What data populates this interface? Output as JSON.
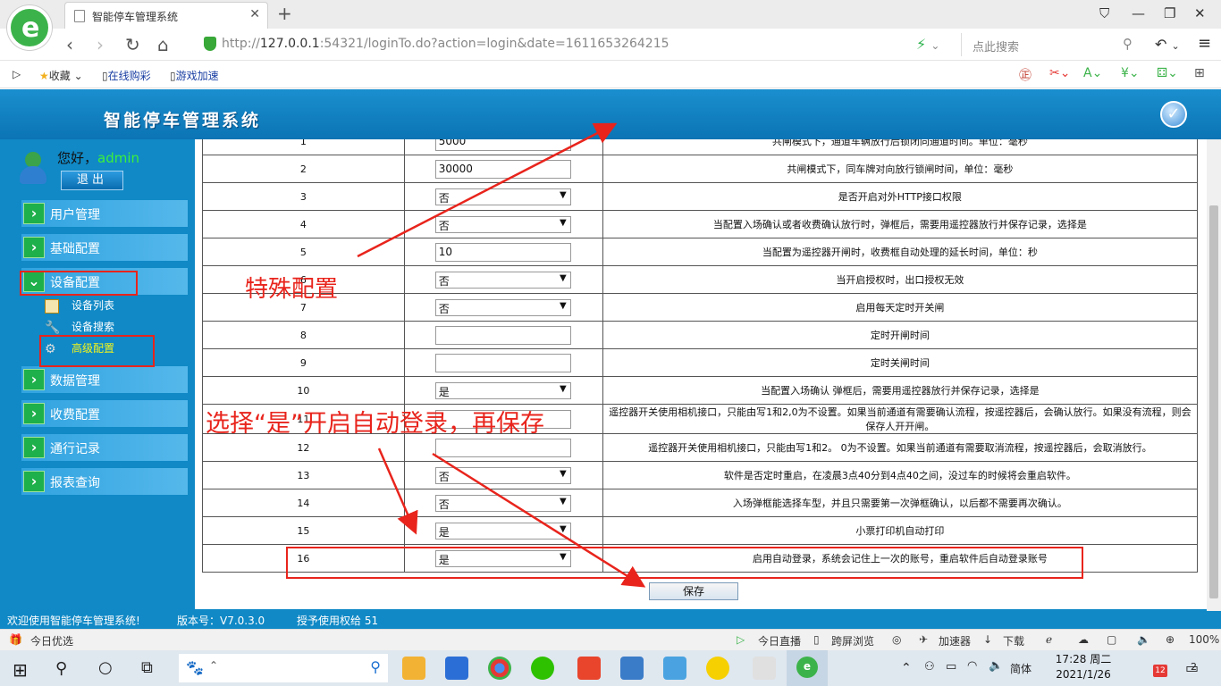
{
  "browser": {
    "tab_title": "智能停车管理系统",
    "url_host": "127.0.0.1",
    "url_prefix": "http://",
    "url_rest": ":54321/loginTo.do?action=login&date=1611653264215",
    "search_placeholder": "点此搜索",
    "bookmarks": [
      "收藏",
      "在线购彩",
      "游戏加速"
    ]
  },
  "app": {
    "title": "智能停车管理系统",
    "greeting": "您好，",
    "username": "admin",
    "logout_label": "退出",
    "menu": [
      {
        "label": "用户管理"
      },
      {
        "label": "基础配置"
      },
      {
        "label": "设备配置"
      },
      {
        "label": "数据管理"
      },
      {
        "label": "收费配置"
      },
      {
        "label": "通行记录"
      },
      {
        "label": "报表查询"
      }
    ],
    "submenu": [
      {
        "label": "设备列表"
      },
      {
        "label": "设备搜索"
      },
      {
        "label": "高级配置"
      }
    ],
    "save_label": "保存",
    "status": {
      "welcome": "欢迎使用智能停车管理系统!",
      "version": "版本号：V7.0.3.0",
      "license": "授予使用权给 51"
    }
  },
  "config_rows": [
    {
      "no": "1",
      "type": "input",
      "value": "5000",
      "desc": "共闸模式下，通道车辆放行后锁闭同通道时间。单位：毫秒"
    },
    {
      "no": "2",
      "type": "input",
      "value": "30000",
      "desc": "共闸模式下，同车牌对向放行锁闸时间，单位：毫秒"
    },
    {
      "no": "3",
      "type": "select",
      "value": "否",
      "desc": "是否开启对外HTTP接口权限"
    },
    {
      "no": "4",
      "type": "select",
      "value": "否",
      "desc": "当配置入场确认或者收费确认放行时，弹框后，需要用遥控器放行并保存记录，选择是"
    },
    {
      "no": "5",
      "type": "input",
      "value": "10",
      "desc": "当配置为遥控器开闸时，收费框自动处理的延长时间，单位：秒"
    },
    {
      "no": "6",
      "type": "select",
      "value": "否",
      "desc": "当开启授权时，出口授权无效"
    },
    {
      "no": "7",
      "type": "select",
      "value": "否",
      "desc": "启用每天定时开关闸"
    },
    {
      "no": "8",
      "type": "input",
      "value": "",
      "desc": "定时开闸时间"
    },
    {
      "no": "9",
      "type": "input",
      "value": "",
      "desc": "定时关闸时间"
    },
    {
      "no": "10",
      "type": "select",
      "value": "是",
      "desc": "当配置入场确认 弹框后，需要用遥控器放行并保存记录，选择是"
    },
    {
      "no": "11",
      "type": "input",
      "value": "",
      "desc": "遥控器开关使用相机接口，只能由写1和2,0为不设置。如果当前通道有需要确认流程，按遥控器后，会确认放行。如果没有流程，则会保存人开开闸。"
    },
    {
      "no": "12",
      "type": "input",
      "value": "",
      "desc": "遥控器开关使用相机接口，只能由写1和2。 0为不设置。如果当前通道有需要取消流程，按遥控器后，会取消放行。"
    },
    {
      "no": "13",
      "type": "select",
      "value": "否",
      "desc": "软件是否定时重启，在凌晨3点40分到4点40之间，没过车的时候将会重启软件。"
    },
    {
      "no": "14",
      "type": "select",
      "value": "否",
      "desc": "入场弹框能选择车型，并且只需要第一次弹框确认，以后都不需要再次确认。"
    },
    {
      "no": "15",
      "type": "select",
      "value": "是",
      "desc": "小票打印机自动打印"
    },
    {
      "no": "16",
      "type": "select",
      "value": "是",
      "desc": "启用自动登录，系统会记住上一次的账号，重启软件后自动登录账号"
    }
  ],
  "annotations": {
    "special_config": "特殊配置",
    "instruction": "选择“是”开启自动登录，再保存"
  },
  "bottom_bar": {
    "left": "今日优选",
    "live": "今日直播",
    "cross": "跨屏浏览",
    "accel": "加速器",
    "download": "下载",
    "zoom": "100%"
  },
  "taskbar": {
    "ime": "简体",
    "time": "17:28 周二",
    "date": "2021/1/26",
    "notif_count": "12",
    "action_count": "2"
  }
}
